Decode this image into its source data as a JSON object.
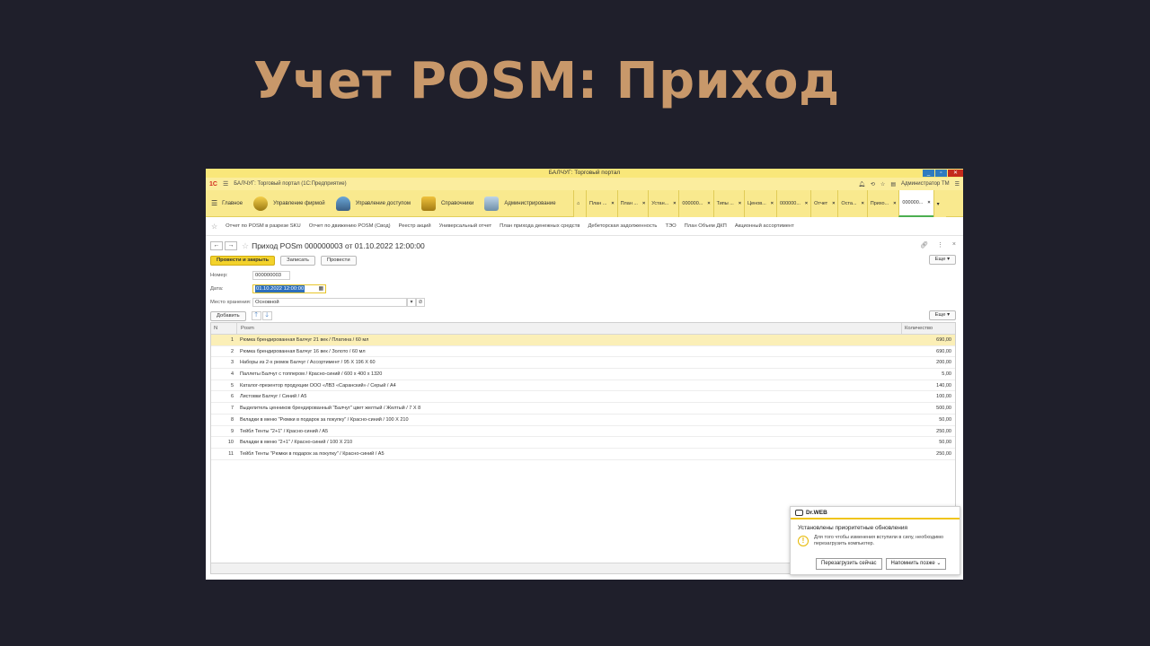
{
  "slide": {
    "title": "Учет POSM: Приход"
  },
  "window": {
    "title": "БАЛЧУГ: Торговый портал"
  },
  "appbar": {
    "title": "БАЛЧУГ: Торговый портал  (1С:Предприятие)",
    "user": "Администратор ТМ"
  },
  "sections": {
    "main": "Главное",
    "firm": "Управление фирмой",
    "access": "Управление доступом",
    "refs": "Справочники",
    "admin": "Администрирование"
  },
  "tabs": [
    "План ...",
    "План ...",
    "Устан...",
    "000000...",
    "Типы ...",
    "Ценов...",
    "000000...",
    "Отчет",
    "Оста...",
    "Прихо...",
    "000000..."
  ],
  "favorites": [
    "Отчет по POSM в разрезе SKU",
    "Отчет по движению POSM (Свод)",
    "Реестр акций",
    "Универсальный отчет",
    "План прихода денежных средств",
    "Дебеторская задолженность",
    "ТЭО",
    "План Объем ДКП",
    "Акционный ассортимент"
  ],
  "document": {
    "title": "Приход POSm 000000003 от 01.10.2022 12:00:00",
    "buttons": {
      "post_close": "Провести и закрыть",
      "save": "Записать",
      "post": "Провести",
      "more": "Еще"
    },
    "fields": {
      "number_label": "Номер:",
      "number_value": "000000003",
      "date_label": "Дата:",
      "date_value": "01.10.2022 12:00:00",
      "storage_label": "Место хранения:",
      "storage_value": "Основной"
    },
    "table_buttons": {
      "add": "Добавить",
      "more": "Еще"
    },
    "columns": {
      "n": "N",
      "posm": "Posm",
      "qty": "Количество"
    },
    "rows": [
      {
        "n": "1",
        "posm": "Рюмка брендированная Балчуг 21 век / Платина / 60 мл",
        "qty": "690,00"
      },
      {
        "n": "2",
        "posm": "Рюмка брендированная Балчуг 16 век / Золото / 60 мл",
        "qty": "690,00"
      },
      {
        "n": "3",
        "posm": "Наборы из 2-х рюмок Балчуг / Ассортимент / 95 X 196 X 60",
        "qty": "200,00"
      },
      {
        "n": "4",
        "posm": "Паллеты Балчуг с топпером / Красно-синий / 600 х 400 х 1320",
        "qty": "5,00"
      },
      {
        "n": "5",
        "posm": "Каталог-презентор продукции ООО «ЛВЗ «Саранский» / Серый / А4",
        "qty": "140,00"
      },
      {
        "n": "6",
        "posm": "Листовки Балчуг / Синий / А5",
        "qty": "100,00"
      },
      {
        "n": "7",
        "posm": "Выделитель ценников брендированный \"Балчуг\" цвет желтый / Желтый / 7 Х 8",
        "qty": "500,00"
      },
      {
        "n": "8",
        "posm": "Вкладки в меню \"Рюмки в подарок за покупку\" / Красно-синий / 100 Х 210",
        "qty": "50,00"
      },
      {
        "n": "9",
        "posm": "Тейбл Тенты \"2+1\" / Красно-синий / А5",
        "qty": "250,00"
      },
      {
        "n": "10",
        "posm": "Вкладки в меню \"2+1\" / Красно-синий / 100 Х 210",
        "qty": "50,00"
      },
      {
        "n": "11",
        "posm": "Тейбл Тенты \"Рюмки в подарок за покупку\" / Красно-синий / А5",
        "qty": "250,00"
      }
    ]
  },
  "toast": {
    "brand": "Dr.WEB",
    "title": "Установлены приоритетные обновления",
    "message": "Для того чтобы изменения вступили в силу, необходимо перезагрузить компьютер.",
    "restart": "Перезагрузить сейчас",
    "remind": "Напомнить позже"
  }
}
